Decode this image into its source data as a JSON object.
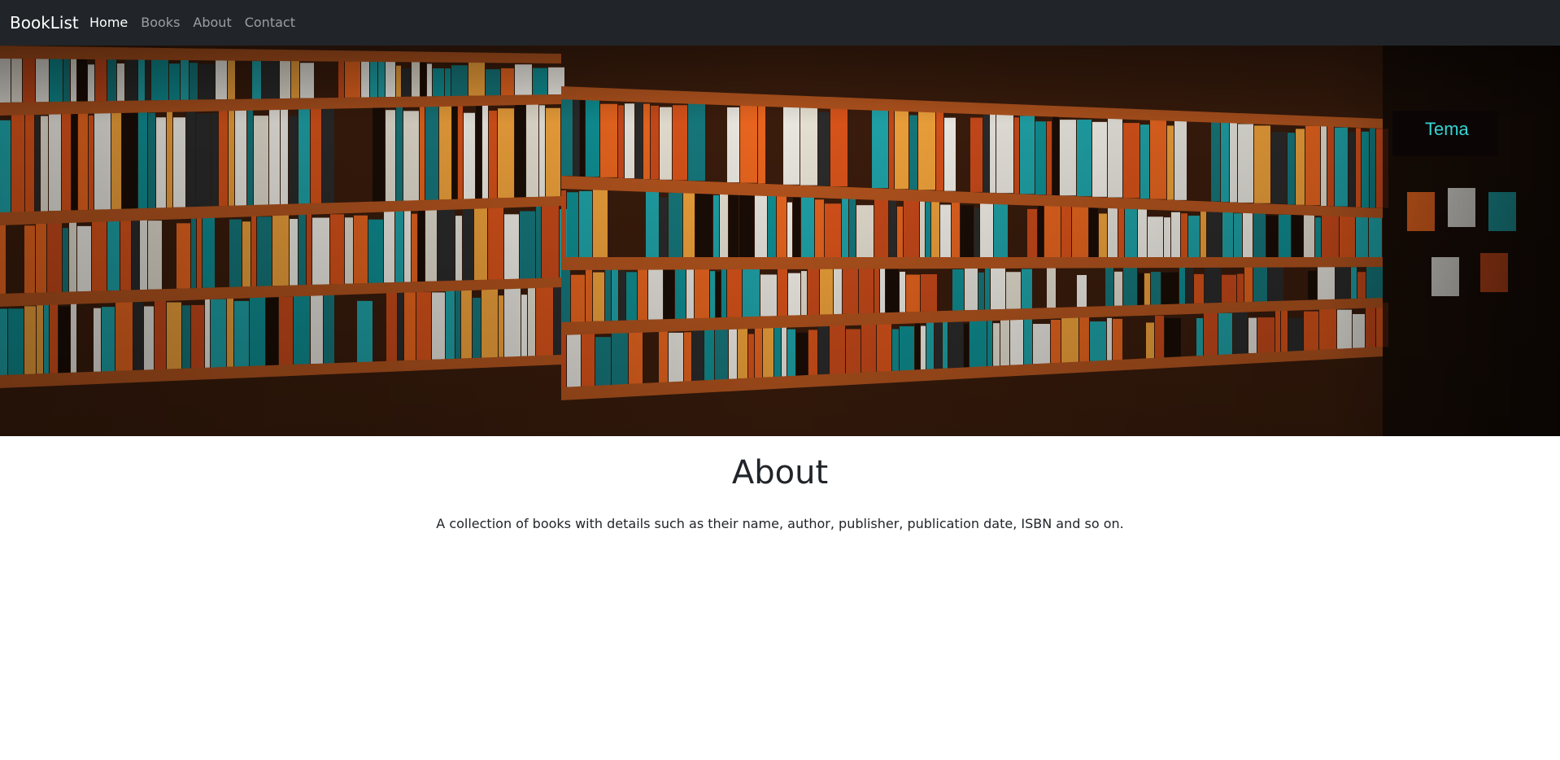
{
  "navbar": {
    "brand": "BookList",
    "links": [
      {
        "label": "Home",
        "active": true
      },
      {
        "label": "Books",
        "active": false
      },
      {
        "label": "About",
        "active": false
      },
      {
        "label": "Contact",
        "active": false
      }
    ]
  },
  "hero": {
    "sign_text": "Tema",
    "colors": {
      "wood": "#b3541e",
      "dark": "#1a0d06",
      "orange": "#e8651f",
      "teal": "#1fa3a8",
      "white": "#e9e6df"
    }
  },
  "about": {
    "heading": "About",
    "description": "A collection of books with details such as their name, author, publisher, publication date, ISBN and so on."
  }
}
